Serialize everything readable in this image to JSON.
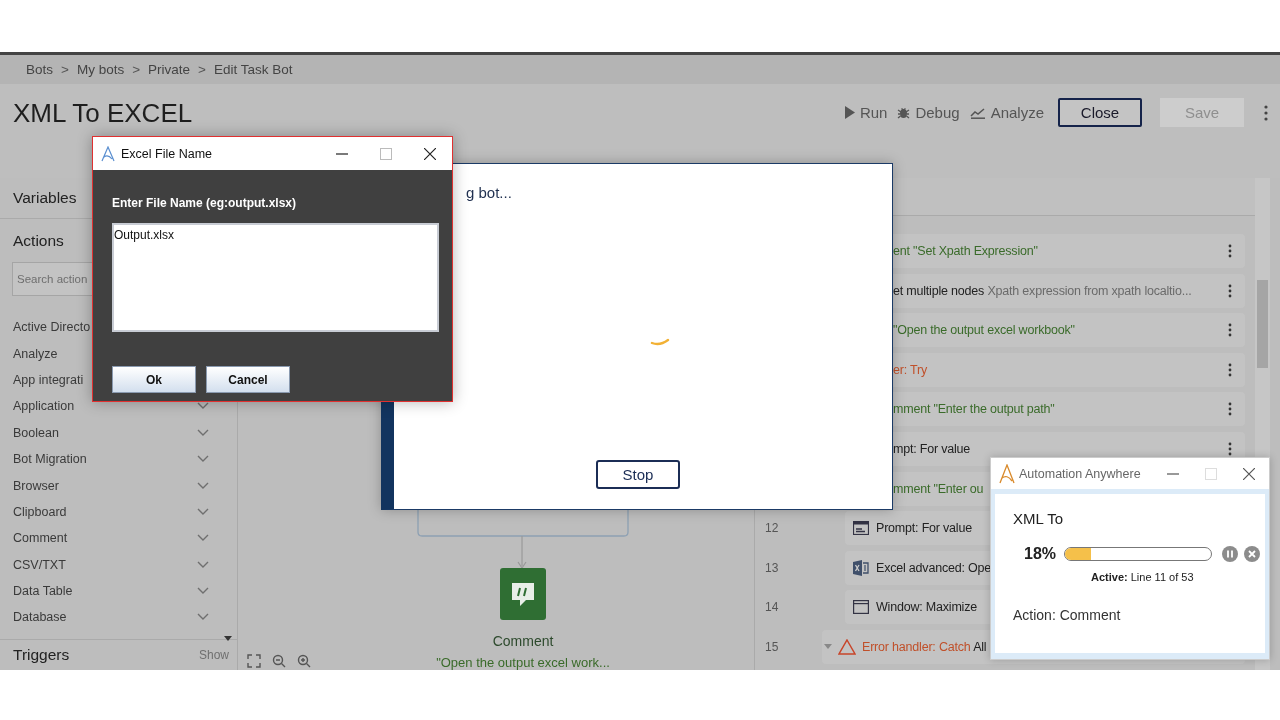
{
  "breadcrumb": {
    "separator": ">",
    "items": [
      "Bots",
      "My bots",
      "Private",
      "Edit Task Bot"
    ]
  },
  "title": "XML To EXCEL",
  "toolbar": [
    {
      "label": "Run",
      "kind": "run"
    },
    {
      "label": "Debug",
      "kind": "debug"
    },
    {
      "label": "Analyze",
      "kind": "analyze"
    }
  ],
  "close_button": {
    "label": "Close"
  },
  "save_button": {
    "label": "Save",
    "disabled": true
  },
  "sidebar": {
    "variables": "Variables",
    "actions": "Actions",
    "search_placeholder": "Search action",
    "triggers": "Triggers",
    "triggers_toggle": "Show",
    "items": [
      {
        "label": "Active Directo",
        "chevron": false
      },
      {
        "label": "Analyze",
        "chevron": false
      },
      {
        "label": "App integrati",
        "chevron": false
      },
      {
        "label": "Application",
        "chevron": true
      },
      {
        "label": "Boolean",
        "chevron": true
      },
      {
        "label": "Bot Migration",
        "chevron": true
      },
      {
        "label": "Browser",
        "chevron": true
      },
      {
        "label": "Clipboard",
        "chevron": true
      },
      {
        "label": "Comment",
        "chevron": true
      },
      {
        "label": "CSV/TXT",
        "chevron": true
      },
      {
        "label": "Data Table",
        "chevron": true
      },
      {
        "label": "Database",
        "chevron": true
      }
    ]
  },
  "canvas": {
    "node": {
      "label": "Comment",
      "caption": "\"Open the output excel work..."
    }
  },
  "steps": [
    {
      "kind": "partial",
      "parts": [
        {
          "text": "ent \"Set Xpath Expression\"",
          "kind": "comment"
        }
      ]
    },
    {
      "kind": "partial",
      "parts": [
        {
          "text": "et multiple nodes",
          "kind": "action"
        },
        {
          "text": "Xpath expression from xpath localtio...",
          "kind": "detail"
        }
      ]
    },
    {
      "kind": "partial",
      "parts": [
        {
          "text": "\"Open the output excel workbook\"",
          "kind": "comment"
        }
      ]
    },
    {
      "kind": "partial",
      "parts": [
        {
          "text": "er: Try",
          "kind": "error"
        }
      ]
    },
    {
      "kind": "partial",
      "parts": [
        {
          "text": "mment \"Enter the output path\"",
          "kind": "comment"
        }
      ]
    },
    {
      "kind": "partial",
      "parts": [
        {
          "text": "mpt: For value",
          "kind": "action"
        }
      ]
    },
    {
      "kind": "partial",
      "parts": [
        {
          "text": "mment \"Enter ou",
          "kind": "comment"
        }
      ]
    },
    {
      "kind": "prompt",
      "number": "12",
      "parts": [
        {
          "text": "Prompt: For value",
          "kind": "action"
        }
      ]
    },
    {
      "kind": "excel",
      "number": "13",
      "parts": [
        {
          "text": "Excel advanced: Ope",
          "kind": "action"
        }
      ]
    },
    {
      "kind": "window",
      "number": "14",
      "parts": [
        {
          "text": "Window: Maximize",
          "kind": "action"
        }
      ]
    },
    {
      "kind": "error-block",
      "number": "15",
      "parts": [
        {
          "text": "Error handler: Catch",
          "kind": "error"
        },
        {
          "text": "All",
          "kind": "action"
        }
      ]
    }
  ],
  "run_dialog": {
    "status": "g bot...",
    "stop": "Stop"
  },
  "file_dialog": {
    "title": "Excel File Name",
    "prompt": "Enter File Name (eg:output.xlsx)",
    "value": "Output.xlsx",
    "buttons": [
      "Ok",
      "Cancel"
    ]
  },
  "progress_window": {
    "title": "Automation Anywhere",
    "bot": "XML To",
    "percent": "18%",
    "level": 0.18,
    "active": "**Active:** Line 11 of 53",
    "action": "Action: Comment"
  }
}
